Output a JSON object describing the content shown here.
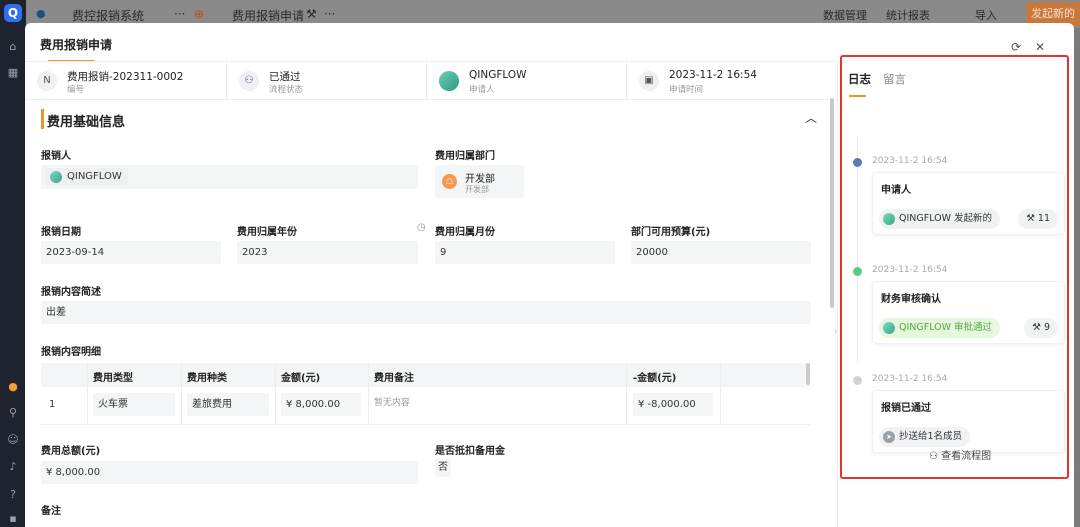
{
  "colors": {
    "accent": "#f0942f",
    "highlight_border": "#e3342f",
    "approved_green": "#4caf38"
  },
  "topbar": {
    "app_name": "费控报销系统",
    "current_form": "费用报销申请",
    "data_manage": "数据管理",
    "stats": "统计报表",
    "import": "导入",
    "new_button": "发起新的"
  },
  "modal": {
    "title": "费用报销申请",
    "summary": [
      {
        "value": "费用报销-202311-0002",
        "label": "编号",
        "icon": "hash-icon"
      },
      {
        "value": "已通过",
        "label": "流程状态",
        "icon": "workflow-icon"
      },
      {
        "value": "QINGFLOW",
        "label": "申请人",
        "icon": "avatar"
      },
      {
        "value": "2023-11-2 16:54",
        "label": "申请时间",
        "icon": "calendar-icon"
      }
    ],
    "section_title": "费用基础信息",
    "fields": {
      "reporter_label": "报销人",
      "reporter_value": "QINGFLOW",
      "dept_label": "费用归属部门",
      "dept_name": "开发部",
      "dept_sub": "开发部",
      "date_label": "报销日期",
      "date_value": "2023-09-14",
      "year_label": "费用归属年份",
      "year_value": "2023",
      "month_label": "费用归属月份",
      "month_value": "9",
      "budget_label": "部门可用预算(元)",
      "budget_value": "20000",
      "summary_label": "报销内容简述",
      "summary_value": "出差",
      "detail_label": "报销内容明细",
      "total_label": "费用总额(元)",
      "total_value": "¥ 8,000.00",
      "deduct_label": "是否抵扣备用金",
      "deduct_value": "否",
      "remark_label": "备注"
    },
    "table": {
      "headers": [
        "费用类型",
        "费用种类",
        "金额(元)",
        "费用备注",
        "-金额(元)"
      ],
      "rows": [
        {
          "index": "1",
          "type": "火车票",
          "kind": "差旅费用",
          "amount": "¥ 8,000.00",
          "note": "暂无内容",
          "neg_amount": "¥ -8,000.00"
        }
      ]
    }
  },
  "log_panel": {
    "tabs": [
      "日志",
      "留言"
    ],
    "entries": [
      {
        "time": "2023-11-2 16:54",
        "title": "申请人",
        "chip": "QINGFLOW 发起新的",
        "count": "11"
      },
      {
        "time": "2023-11-2 16:54",
        "title": "财务审核确认",
        "chip": "QINGFLOW 审批通过",
        "count": "9"
      },
      {
        "time": "2023-11-2 16:54",
        "title": "报销已通过",
        "chip": "抄送给1名成员"
      }
    ],
    "flow_link": "查看流程图"
  }
}
